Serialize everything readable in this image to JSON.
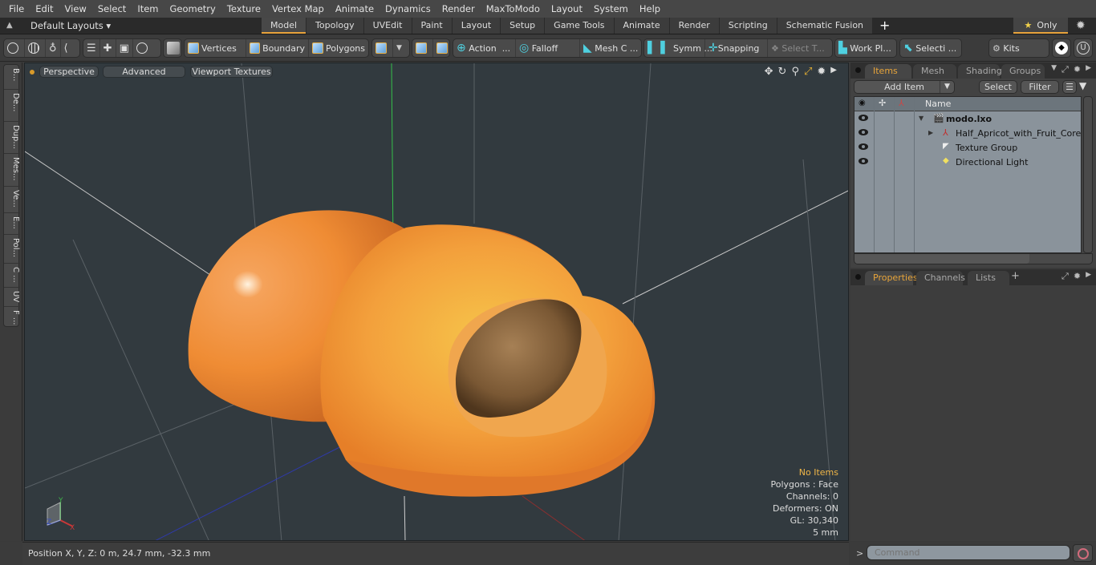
{
  "menu": [
    "File",
    "Edit",
    "View",
    "Select",
    "Item",
    "Geometry",
    "Texture",
    "Vertex Map",
    "Animate",
    "Dynamics",
    "Render",
    "MaxToModo",
    "Layout",
    "System",
    "Help"
  ],
  "layoutbar": {
    "layout_select": "Default Layouts ▾",
    "tabs": [
      "Model",
      "Topology",
      "UVEdit",
      "Paint",
      "Layout",
      "Setup",
      "Game Tools",
      "Animate",
      "Render",
      "Scripting",
      "Schematic Fusion"
    ],
    "active_tab": "Model",
    "add_tab": "+",
    "only_label": "Only"
  },
  "toolbar": {
    "vertices": "Vertices",
    "boundary": "Boundary",
    "polygons": "Polygons",
    "action": "Action",
    "falloff": "Falloff",
    "mesh_c": "Mesh C ...",
    "symm": "Symm ...",
    "snapping": "Snapping",
    "select_t": "Select T...",
    "work_pl": "Work Pl...",
    "selecti": "Selecti ...",
    "kits": "Kits",
    "ellipsis": "..."
  },
  "left_strip": [
    "B...",
    "De...",
    "Dup...",
    "Mes...",
    "Ve...",
    "E...",
    "Pol...",
    "C ...",
    "UV",
    "F ..."
  ],
  "viewport": {
    "header": {
      "view": "Perspective",
      "shading": "Advanced",
      "textures": "Viewport Textures"
    },
    "stats": {
      "selection": "No Items",
      "polygons": "Polygons : Face",
      "channels": "Channels: 0",
      "deformers": "Deformers: ON",
      "gl": "GL: 30,340",
      "scale": "5 mm"
    },
    "axis": {
      "x": "X",
      "y": "Y",
      "z": "Z"
    }
  },
  "items_panel": {
    "tabs": [
      "Items",
      "Mesh ...",
      "Shading",
      "Groups"
    ],
    "active_tab": "Items",
    "add_item": "Add Item",
    "select": "Select",
    "filter": "Filter",
    "column_name": "Name",
    "rows": [
      {
        "name": "modo.lxo",
        "bold": true
      },
      {
        "name": "Half_Apricot_with_Fruit_Core"
      },
      {
        "name": "Texture Group"
      },
      {
        "name": "Directional Light"
      }
    ]
  },
  "properties_panel": {
    "tabs": [
      "Properties",
      "Channels",
      "Lists"
    ],
    "active_tab": "Properties",
    "add_tab": "+"
  },
  "statusbar": {
    "position": "Position X, Y, Z:   0 m, 24.7 mm, -32.3 mm"
  },
  "command": {
    "prompt": ">",
    "placeholder": "Command"
  },
  "colors": {
    "accent": "#e8a33c",
    "viewport_bg": "#323a3f",
    "apricot": "#f0922e",
    "stone": "#7a5a38"
  }
}
